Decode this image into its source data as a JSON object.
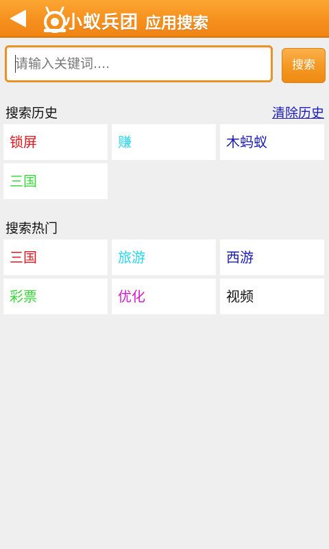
{
  "header": {
    "back_icon": "back-arrow-icon",
    "logo_icon": "ant-mascot-icon",
    "logo_text": "小蚁兵团",
    "title": "应用搜索",
    "colors": {
      "bar": "#f6901d",
      "text": "#ffffff"
    }
  },
  "search": {
    "placeholder": "请输入关键词....",
    "value": "",
    "button_label": "搜索"
  },
  "history": {
    "title": "搜索历史",
    "clear_label": "清除历史",
    "items": [
      {
        "label": "锁屏",
        "color": "#e0161c"
      },
      {
        "label": "赚",
        "color": "#29d6ec"
      },
      {
        "label": "木蚂蚁",
        "color": "#1c1cb4"
      },
      {
        "label": "三国",
        "color": "#37d837"
      }
    ]
  },
  "hot": {
    "title": "搜索热门",
    "items": [
      {
        "label": "三国",
        "color": "#e0161c"
      },
      {
        "label": "旅游",
        "color": "#29d6ec"
      },
      {
        "label": "西游",
        "color": "#1c1cb4"
      },
      {
        "label": "彩票",
        "color": "#37d837"
      },
      {
        "label": "优化",
        "color": "#d21cd2"
      },
      {
        "label": "视频",
        "color": "#111111"
      }
    ]
  }
}
